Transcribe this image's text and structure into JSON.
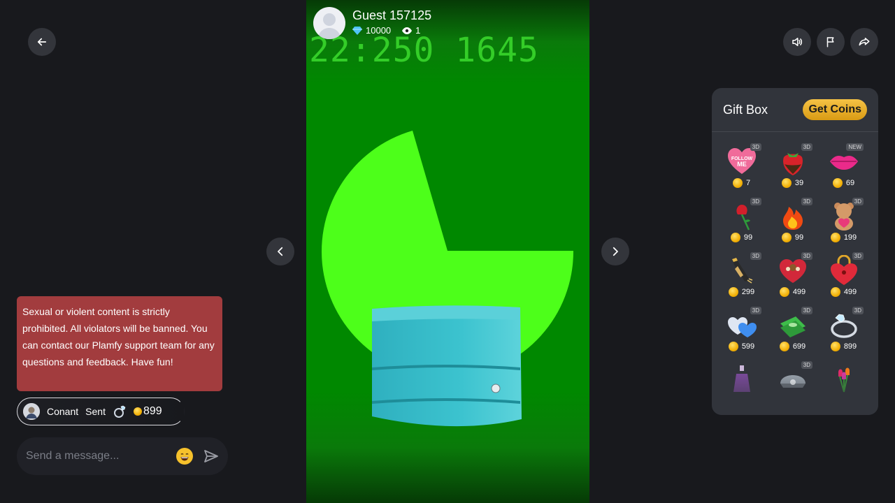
{
  "streamer": {
    "name": "Guest 157125",
    "diamonds": "10000",
    "viewers": "1",
    "clock_text": "22:250 1645"
  },
  "warning": {
    "text": "Sexual or violent content is strictly prohibited. All violators will be banned. You can contact our Plamfy support team for any questions and feedback. Have fun!"
  },
  "gift_message": {
    "user": "Conant",
    "action": "Sent",
    "amount": "899"
  },
  "chat_input": {
    "placeholder": "Send a message..."
  },
  "giftbox": {
    "title": "Gift Box",
    "get_coins_label": "Get Coins",
    "gifts": [
      {
        "name": "follow-me-heart",
        "price": "7",
        "tag": "3D"
      },
      {
        "name": "strawberry",
        "price": "39",
        "tag": "3D"
      },
      {
        "name": "kiss-lips",
        "price": "69",
        "tag": "NEW"
      },
      {
        "name": "rose",
        "price": "99",
        "tag": "3D"
      },
      {
        "name": "fire",
        "price": "99",
        "tag": "3D"
      },
      {
        "name": "teddy-bear",
        "price": "199",
        "tag": "3D"
      },
      {
        "name": "champagne",
        "price": "299",
        "tag": "3D"
      },
      {
        "name": "heart-chocolate-box",
        "price": "499",
        "tag": "3D"
      },
      {
        "name": "heart-lock",
        "price": "499",
        "tag": "3D"
      },
      {
        "name": "twin-hearts",
        "price": "599",
        "tag": "3D"
      },
      {
        "name": "money-stack",
        "price": "699",
        "tag": "3D"
      },
      {
        "name": "diamond-ring",
        "price": "899",
        "tag": "3D"
      },
      {
        "name": "perfume",
        "price": "",
        "tag": ""
      },
      {
        "name": "pearl-shell",
        "price": "",
        "tag": "3D"
      },
      {
        "name": "tulips",
        "price": "",
        "tag": ""
      }
    ]
  },
  "colors": {
    "background": "#18191d",
    "warning_bg": "#a23c3e",
    "video_green": "#008800",
    "pie_green": "#4dff1a",
    "coin_gold": "#f2b007",
    "panel_bg": "#31343b"
  }
}
